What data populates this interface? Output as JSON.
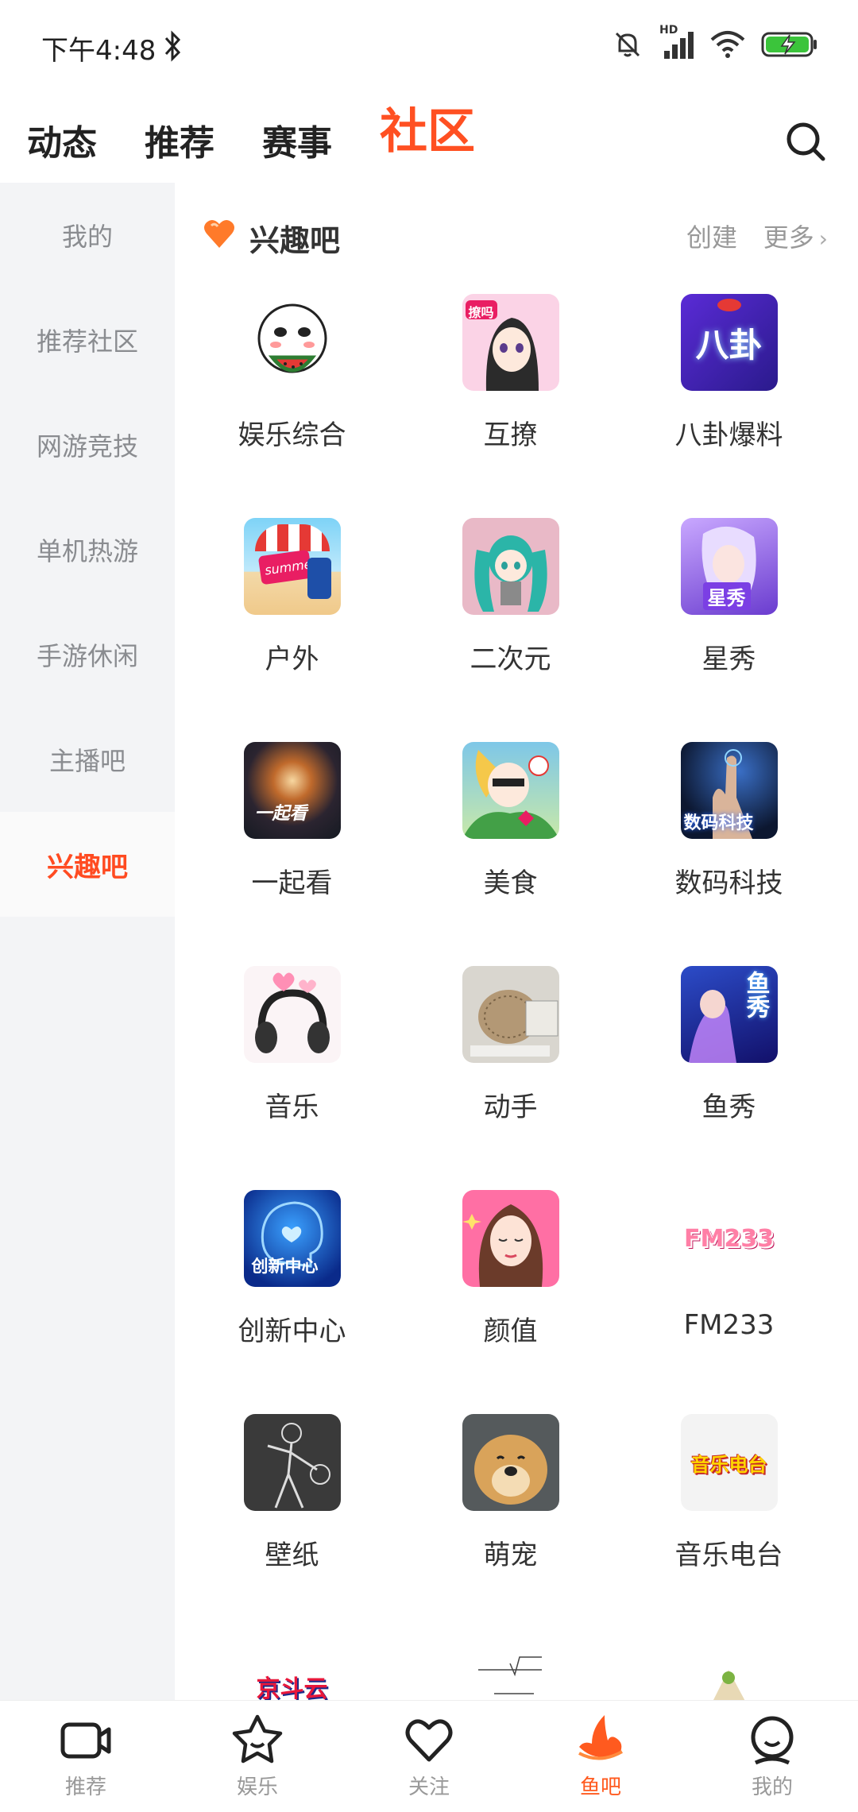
{
  "status": {
    "time": "下午4:48",
    "network_label": "HD"
  },
  "header": {
    "tabs": [
      {
        "label": "动态"
      },
      {
        "label": "推荐"
      },
      {
        "label": "赛事"
      },
      {
        "label": "社区"
      }
    ],
    "active_tab": "社区"
  },
  "sidebar": {
    "items": [
      {
        "label": "我的"
      },
      {
        "label": "推荐社区"
      },
      {
        "label": "网游竞技"
      },
      {
        "label": "单机热游"
      },
      {
        "label": "手游休闲"
      },
      {
        "label": "主播吧"
      },
      {
        "label": "兴趣吧"
      }
    ],
    "active": "兴趣吧"
  },
  "section": {
    "title": "兴趣吧",
    "create_label": "创建",
    "more_label": "更多"
  },
  "grid": {
    "items": [
      {
        "label": "娱乐综合",
        "icon": "watermelon-face-icon"
      },
      {
        "label": "互撩",
        "icon": "anime-girl-icon",
        "badge_text": "撩吗"
      },
      {
        "label": "八卦爆料",
        "icon": "gossip-icon",
        "badge_text": "八卦"
      },
      {
        "label": "户外",
        "icon": "summer-luggage-icon",
        "badge_text": "summer"
      },
      {
        "label": "二次元",
        "icon": "miku-icon"
      },
      {
        "label": "星秀",
        "icon": "star-show-icon",
        "badge_text": "星秀"
      },
      {
        "label": "一起看",
        "icon": "watch-together-icon",
        "badge_text": "一起看"
      },
      {
        "label": "美食",
        "icon": "food-icon"
      },
      {
        "label": "数码科技",
        "icon": "digital-tech-icon",
        "badge_text": "数码科技"
      },
      {
        "label": "音乐",
        "icon": "headphones-icon"
      },
      {
        "label": "动手",
        "icon": "hedgehog-icon"
      },
      {
        "label": "鱼秀",
        "icon": "fish-show-icon",
        "badge_text": "鱼秀"
      },
      {
        "label": "创新中心",
        "icon": "innovation-brain-icon",
        "badge_text": "创新中心"
      },
      {
        "label": "颜值",
        "icon": "beauty-face-icon"
      },
      {
        "label": "FM233",
        "icon": "fm233-logo-icon",
        "badge_text": "FM233"
      },
      {
        "label": "壁纸",
        "icon": "wallpaper-icon"
      },
      {
        "label": "萌宠",
        "icon": "cute-dog-icon"
      },
      {
        "label": "音乐电台",
        "icon": "music-radio-icon",
        "badge_text": "音乐电台"
      },
      {
        "label": "",
        "icon": "jingdouyun-logo-icon",
        "badge_text": "京斗云"
      },
      {
        "label": "",
        "icon": "math-formula-icon"
      },
      {
        "label": "",
        "icon": "landscape-art-icon"
      }
    ]
  },
  "bottom_nav": {
    "items": [
      {
        "label": "推荐",
        "icon": "video-camera-icon"
      },
      {
        "label": "娱乐",
        "icon": "star-face-icon"
      },
      {
        "label": "关注",
        "icon": "heart-outline-icon"
      },
      {
        "label": "鱼吧",
        "icon": "fish-bar-icon"
      },
      {
        "label": "我的",
        "icon": "profile-face-icon"
      }
    ],
    "active": "鱼吧"
  },
  "colors": {
    "accent": "#ff5022",
    "sidebar_bg": "#f3f4f6",
    "muted_text": "#8a8c90"
  }
}
